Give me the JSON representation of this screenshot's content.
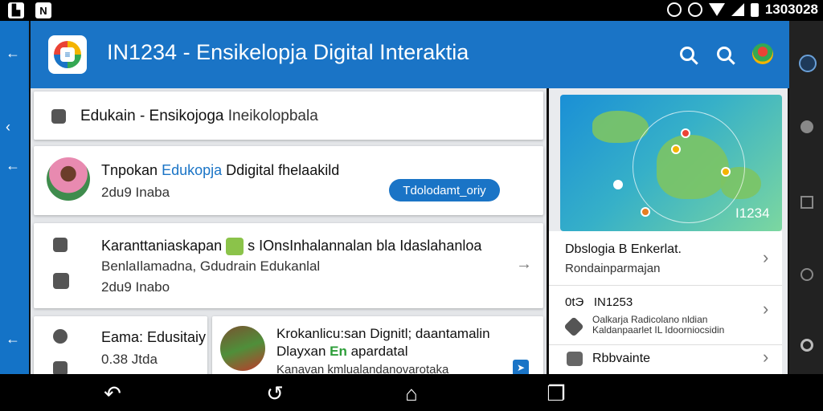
{
  "status_bar": {
    "left_icons": [
      "gallery-icon",
      "notification-n-icon"
    ],
    "left_glyphs": [
      "▙",
      "N"
    ],
    "clock": "1303028"
  },
  "app_bar": {
    "title": "IN1234 - Ensikelopja Digital Interaktia",
    "actions": [
      "search-icon",
      "search-icon",
      "account-icon"
    ]
  },
  "cards": {
    "header": {
      "title": "Edukain - Ensikojoga",
      "subtitle": "Inеikolopbala"
    },
    "featured": {
      "title_parts": [
        "Tnpokan ",
        "Edukopja",
        " Ddigital fhelaakild"
      ],
      "meta": "2du9 Inaba",
      "button": "Tdolodamt_oriy"
    },
    "article": {
      "title_part1": "Karanttaniaskapan",
      "title_part2": "s IOnsInhalannalan bla Idaslahanloa",
      "subtitle": "BenlaIlamadna, Gdudrain Edukanlal",
      "meta": "2du9 Inabo"
    },
    "small_left": {
      "title": "Eama: Edusitaiy",
      "meta": "0.38 Jtda"
    },
    "small_right": {
      "line1": "Krokanlicu:san Dignitl; daantamalin",
      "line2_a": "Dlayxan ",
      "line2_b": "En",
      "line2_c": " apardatal",
      "line3": "Kanavan kmlualandanovarotaka"
    }
  },
  "right_panel": {
    "map_label": "I1234",
    "rows": [
      {
        "title": "Dbslogia B Enkerlat.",
        "subtitle": "Rondainparmajan"
      },
      {
        "prefix": "0tЭ",
        "title": "IN1253",
        "subtitle": "Oalkarja Radicolano nldian Kaldanpaarlet IL Idoorniocsidin"
      },
      {
        "title": "Rbbvainte"
      }
    ]
  },
  "nav_bar": {
    "buttons": [
      "back-icon",
      "undo-icon",
      "home-icon",
      "recents-icon"
    ],
    "glyphs": [
      "↶",
      "↺",
      "⌂",
      "❐"
    ]
  },
  "colors": {
    "primary": "#1a74c6",
    "accent_green": "#2e9e3a",
    "background": "#e4e6e9"
  }
}
